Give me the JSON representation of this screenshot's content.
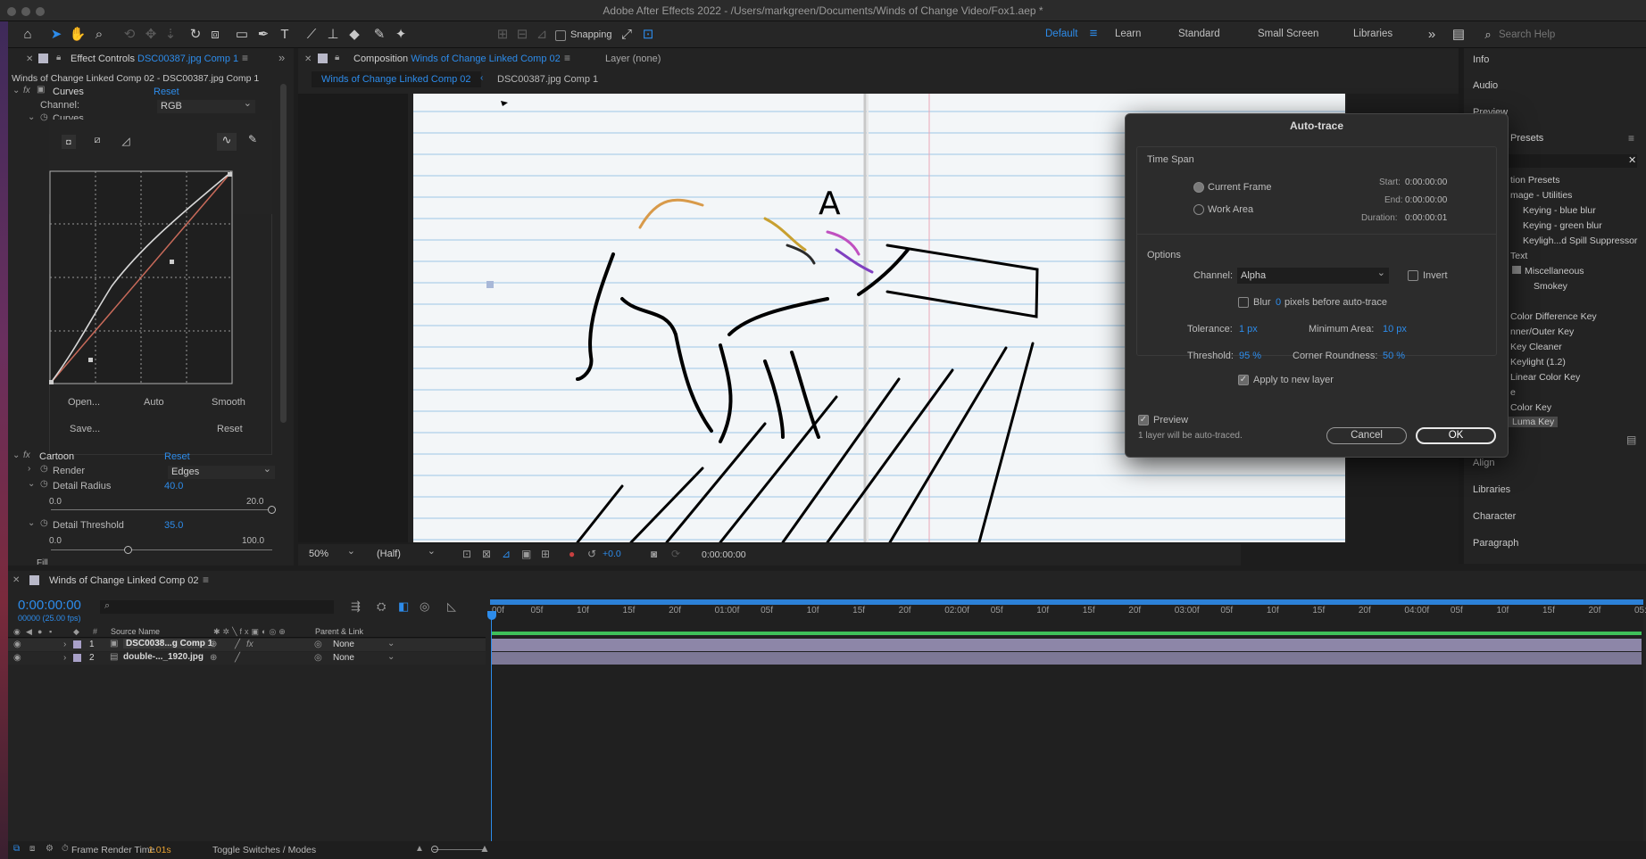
{
  "window": {
    "title": "Adobe After Effects 2022 - /Users/markgreen/Documents/Winds of Change Video/Fox1.aep *"
  },
  "toolbar": {
    "snapping_label": "Snapping",
    "workspaces": [
      "Default",
      "Learn",
      "Standard",
      "Small Screen",
      "Libraries"
    ],
    "active_workspace": "Default",
    "search_placeholder": "Search Help"
  },
  "effect_controls": {
    "tab_label": "Effect Controls",
    "tab_layer": "DSC00387.jpg Comp 1",
    "breadcrumb": "Winds of Change Linked Comp 02 - DSC00387.jpg Comp 1",
    "curves": {
      "name": "Curves",
      "reset": "Reset",
      "channel_label": "Channel:",
      "channel_value": "RGB",
      "sub_label": "Curves",
      "buttons": [
        "Open...",
        "Auto",
        "Smooth",
        "Save...",
        "Reset"
      ]
    },
    "cartoon": {
      "name": "Cartoon",
      "reset": "Reset",
      "render_label": "Render",
      "render_value": "Edges",
      "detail_radius_label": "Detail Radius",
      "detail_radius_value": "40.0",
      "detail_radius_min": "0.0",
      "detail_radius_max": "20.0",
      "detail_radius_level": 1.0,
      "detail_threshold_label": "Detail Threshold",
      "detail_threshold_value": "35.0",
      "detail_threshold_min": "0.0",
      "detail_threshold_max": "100.0",
      "detail_threshold_level": 0.35,
      "fill_label": "Fill"
    }
  },
  "composition": {
    "tab_prefix": "Composition",
    "tab_name": "Winds of Change Linked Comp 02",
    "layer_tab": "Layer (none)",
    "breadcrumb": [
      "Winds of Change Linked Comp 02",
      "DSC00387.jpg Comp 1"
    ],
    "zoom": "50%",
    "resolution": "(Half)",
    "exposure": "+0.0",
    "timecode": "0:00:00:00"
  },
  "dialog": {
    "title": "Auto-trace",
    "time_span_label": "Time Span",
    "current_frame": "Current Frame",
    "work_area": "Work Area",
    "start_label": "Start:",
    "start_value": "0:00:00:00",
    "end_label": "End:",
    "end_value": "0:00:00:00",
    "duration_label": "Duration:",
    "duration_value": "0:00:00:01",
    "options_label": "Options",
    "channel_label": "Channel:",
    "channel_value": "Alpha",
    "invert_label": "Invert",
    "blur_label": "Blur",
    "blur_value": "0",
    "blur_suffix": "pixels before auto-trace",
    "tolerance_label": "Tolerance:",
    "tolerance_value": "1 px",
    "min_area_label": "Minimum Area:",
    "min_area_value": "10 px",
    "threshold_label": "Threshold:",
    "threshold_value": "95 %",
    "corner_label": "Corner Roundness:",
    "corner_value": "50 %",
    "apply_label": "Apply to new layer",
    "preview_label": "Preview",
    "info_text": "1 layer will be auto-traced.",
    "cancel": "Cancel",
    "ok": "OK"
  },
  "right_panel": {
    "items": [
      "Info",
      "Audio",
      "Preview"
    ],
    "presets_tab": "Presets",
    "presets": [
      "tion Presets",
      "mage - Utilities",
      "Keying - blue blur",
      "Keying - green blur",
      "Keyligh...d Spill Suppressor",
      "Text",
      "Miscellaneous",
      "Smokey",
      "Color Difference Key",
      "nner/Outer Key",
      "Key Cleaner",
      "Keylight (1.2)",
      "Linear Color Key",
      "e",
      "Color Key",
      "Luma Key"
    ],
    "bottom_items": [
      "Align",
      "Libraries",
      "Character",
      "Paragraph"
    ]
  },
  "timeline": {
    "tab_label": "Winds of Change Linked Comp 02",
    "timecode": "0:00:00:00",
    "fps": "00000 (25.00 fps)",
    "columns": {
      "source_name": "Source Name",
      "parent": "Parent & Link"
    },
    "layers": [
      {
        "num": "1",
        "name": "DSC0038...g Comp 1",
        "parent": "None"
      },
      {
        "num": "2",
        "name": "double-..._1920.jpg",
        "parent": "None"
      }
    ],
    "ruler": [
      "00f",
      "05f",
      "10f",
      "15f",
      "20f",
      "01:00f",
      "05f",
      "10f",
      "15f",
      "20f",
      "02:00f",
      "05f",
      "10f",
      "15f",
      "20f",
      "03:00f",
      "05f",
      "10f",
      "15f",
      "20f",
      "04:00f",
      "05f",
      "10f",
      "15f",
      "20f",
      "05:0"
    ]
  },
  "status": {
    "render_label": "Frame Render Time",
    "render_value": "1.01s",
    "toggle_label": "Toggle Switches / Modes"
  },
  "colors": {
    "accent": "#2d8ceb",
    "panel": "#232323",
    "track": "#8d86a8",
    "workarea": "#3fbf5a"
  }
}
